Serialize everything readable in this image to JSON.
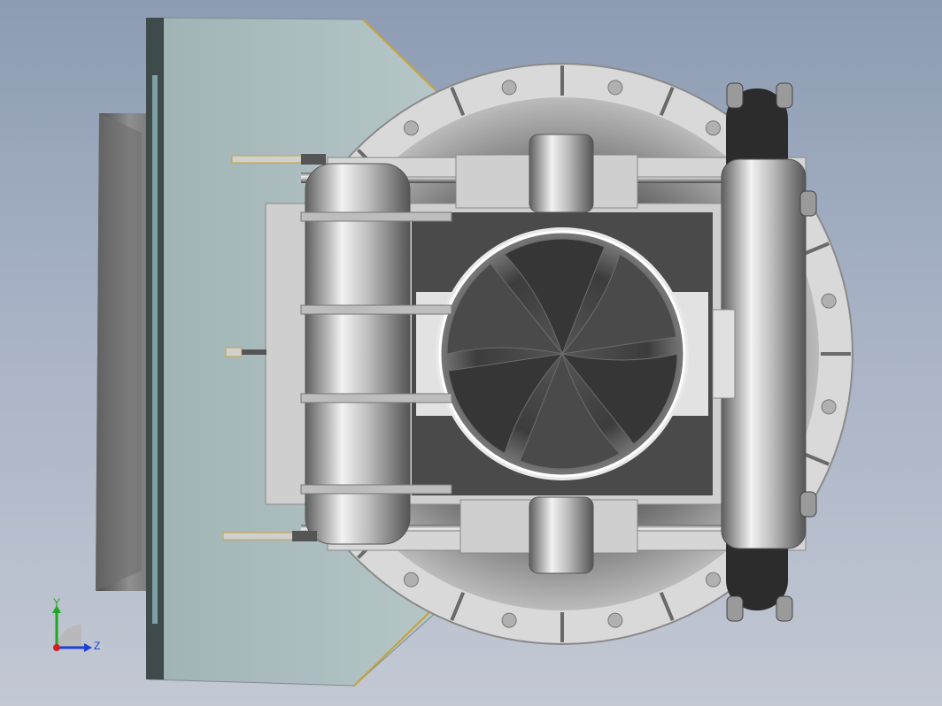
{
  "view": {
    "background_top": "#8d9cb3",
    "background_bottom": "#c3c8d3"
  },
  "model": {
    "component": "fan-damper-assembly",
    "material_colors": {
      "housing_plate": "#a9bdbe",
      "steel_light": "#e4e4e4",
      "steel_mid": "#a8a8a8",
      "steel_dark": "#3a3a3a",
      "edge_highlight": "#c8a23a"
    }
  },
  "triad": {
    "y_label": "Y",
    "z_label": "Z",
    "y_color": "#1fa81f",
    "z_color": "#1f3fd6",
    "x_color": "#d61f1f"
  }
}
